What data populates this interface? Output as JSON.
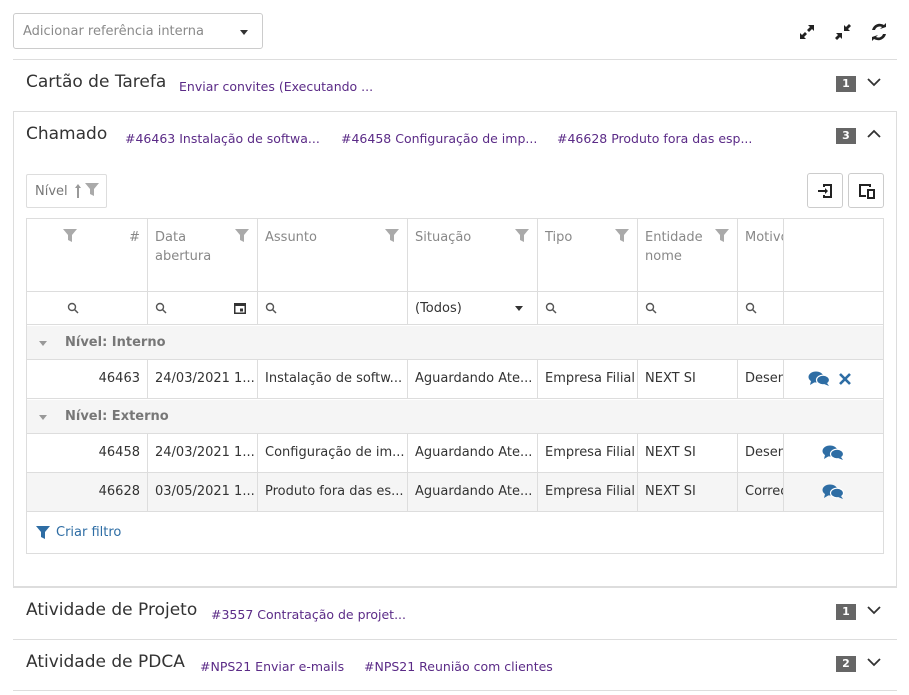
{
  "ref_select": {
    "placeholder": "Adicionar referência interna"
  },
  "toolbar_icons": [
    "expand-icon",
    "collapse-icon",
    "refresh-icon"
  ],
  "sections": {
    "cartao": {
      "title": "Cartão de Tarefa",
      "links": [
        "Enviar convites (Executando ..."
      ],
      "count": "1"
    },
    "chamado": {
      "title": "Chamado",
      "links": [
        "#46463 Instalação de softwa...",
        "#46458 Configuração de imp...",
        "#46628 Produto fora das esp..."
      ],
      "count": "3"
    },
    "atividade_projeto": {
      "title": "Atividade de Projeto",
      "links": [
        "#3557 Contratação de projet..."
      ],
      "count": "1"
    },
    "atividade_pdca": {
      "title": "Atividade de PDCA",
      "links": [
        "#NPS21 Enviar e-mails",
        "#NPS21 Reunião com clientes"
      ],
      "count": "2"
    }
  },
  "grid": {
    "group_chip": "Nível",
    "columns": [
      "#",
      "Data abertura",
      "Assunto",
      "Situação",
      "Tipo",
      "Entidade nome",
      "Motivo"
    ],
    "situacao_filter": "(Todos)",
    "groups": [
      {
        "label": "Nível: Interno",
        "rows": [
          {
            "num": "46463",
            "data": "24/03/2021 1...",
            "assunto": "Instalação de softw...",
            "situacao": "Aguardando Ate...",
            "tipo": "Empresa Filial",
            "entidade": "NEXT SI",
            "motivo": "Desen"
          }
        ]
      },
      {
        "label": "Nível: Externo",
        "rows": [
          {
            "num": "46458",
            "data": "24/03/2021 1...",
            "assunto": "Configuração de im...",
            "situacao": "Aguardando Ate...",
            "tipo": "Empresa Filial",
            "entidade": "NEXT SI",
            "motivo": "Desen"
          },
          {
            "num": "46628",
            "data": "03/05/2021 1...",
            "assunto": "Produto fora das es...",
            "situacao": "Aguardando Ate...",
            "tipo": "Empresa Filial",
            "entidade": "NEXT SI",
            "motivo": "Correç"
          }
        ]
      }
    ],
    "create_filter": "Criar filtro"
  },
  "colors": {
    "link": "#5b2b87",
    "action_blue": "#2e6da4",
    "badge": "#666666"
  }
}
